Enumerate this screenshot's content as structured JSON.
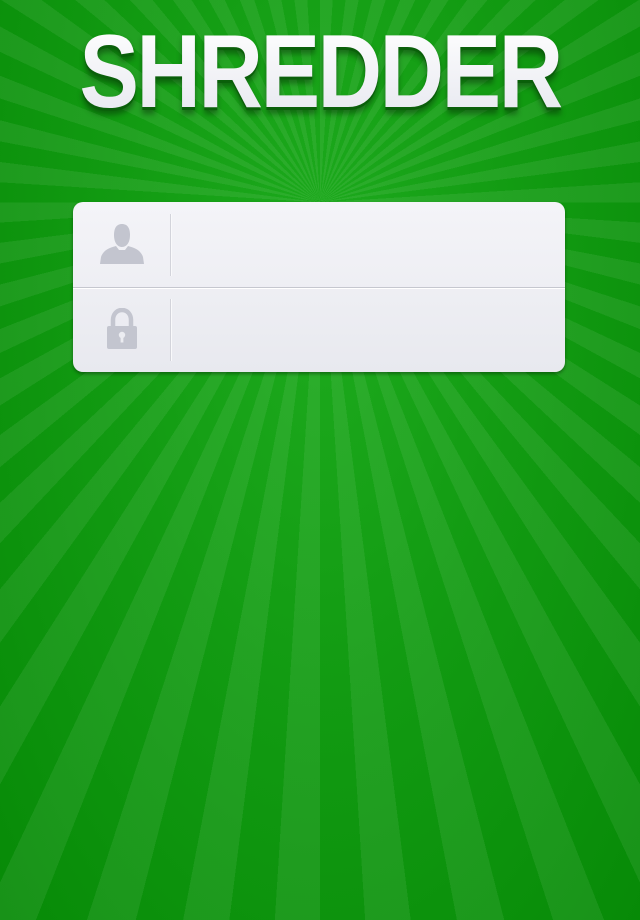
{
  "app": {
    "logo_text": "SHREDDER"
  },
  "login": {
    "username": {
      "icon": "user-silhouette-icon",
      "value": "",
      "placeholder": ""
    },
    "password": {
      "icon": "padlock-icon",
      "value": "",
      "placeholder": ""
    }
  },
  "colors": {
    "background": "#0b8f0b",
    "background_ray": "#1eab1e",
    "panel": "#ebecf1",
    "icon": "#c3c5cf",
    "logo_text": "#f1f2f7"
  }
}
